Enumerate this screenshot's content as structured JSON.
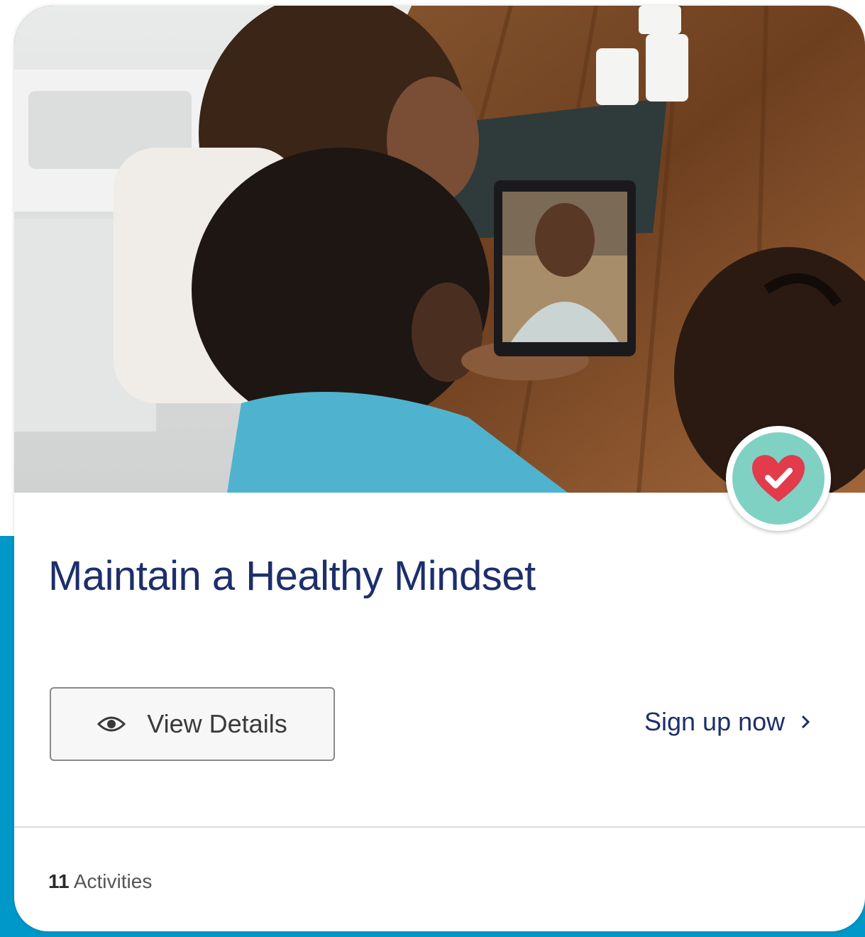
{
  "card": {
    "title": "Maintain a Healthy Mindset",
    "image_alt": "Family video-calling on a tablet at a kitchen counter",
    "badge_icon": "heart-check-icon",
    "view_details_label": "View Details",
    "view_details_icon": "eye-icon",
    "sign_up_label": "Sign up now",
    "sign_up_icon": "chevron-right-icon",
    "activities_count": "11",
    "activities_label": "Activities"
  },
  "colors": {
    "background_blue": "#0097c9",
    "title_navy": "#1d2e6b",
    "badge_teal": "#7fd1c4",
    "heart_red": "#e23b4c"
  }
}
